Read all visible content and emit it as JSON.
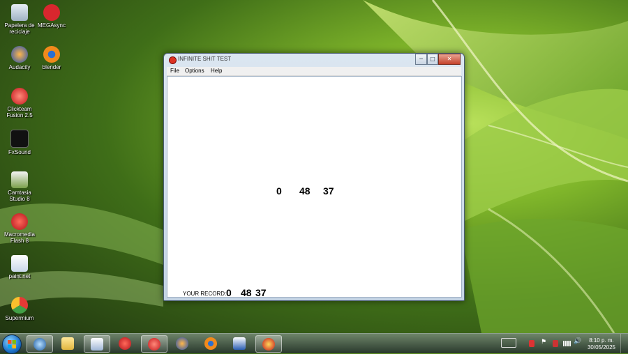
{
  "desktop": {
    "icons": [
      {
        "label": "Papelera de reciclaje",
        "icon": "recycle-bin-icon"
      },
      {
        "label": "MEGAsync",
        "icon": "megasync-icon"
      },
      {
        "label": "Audacity",
        "icon": "audacity-icon"
      },
      {
        "label": "blender",
        "icon": "blender-icon"
      },
      {
        "label": "Clickteam Fusion 2.5",
        "icon": "clickteam-icon"
      },
      {
        "label": "FxSound",
        "icon": "fxsound-icon"
      },
      {
        "label": "Camtasia Studio 8",
        "icon": "camtasia-icon"
      },
      {
        "label": "Macromedia Flash 8",
        "icon": "flash-icon"
      },
      {
        "label": "paint.net",
        "icon": "paintnet-icon"
      },
      {
        "label": "Supermium",
        "icon": "supermium-icon"
      }
    ]
  },
  "window": {
    "title": "INFINITE SHIT TEST",
    "buttons": {
      "minimize": "─",
      "maximize": "□",
      "close": "✕"
    },
    "menu": [
      "File",
      "Options",
      "Help"
    ],
    "counter": {
      "h": "0",
      "m": "48",
      "s": "37"
    },
    "record": {
      "label": "YOUR RECORD:",
      "h": "0",
      "m": "48",
      "s": "37"
    }
  },
  "taskbar": {
    "apps": [
      "camera-icon",
      "folder-icon",
      "paint-icon",
      "flash-icon",
      "clickteam-icon",
      "audacity-icon",
      "blender-icon",
      "word-icon",
      "game-icon"
    ],
    "clock": {
      "time": "8:10 p. m.",
      "date": "30/05/2025"
    }
  },
  "colors": {
    "accent": "#c4412a",
    "window_bg": "#ffffff"
  }
}
